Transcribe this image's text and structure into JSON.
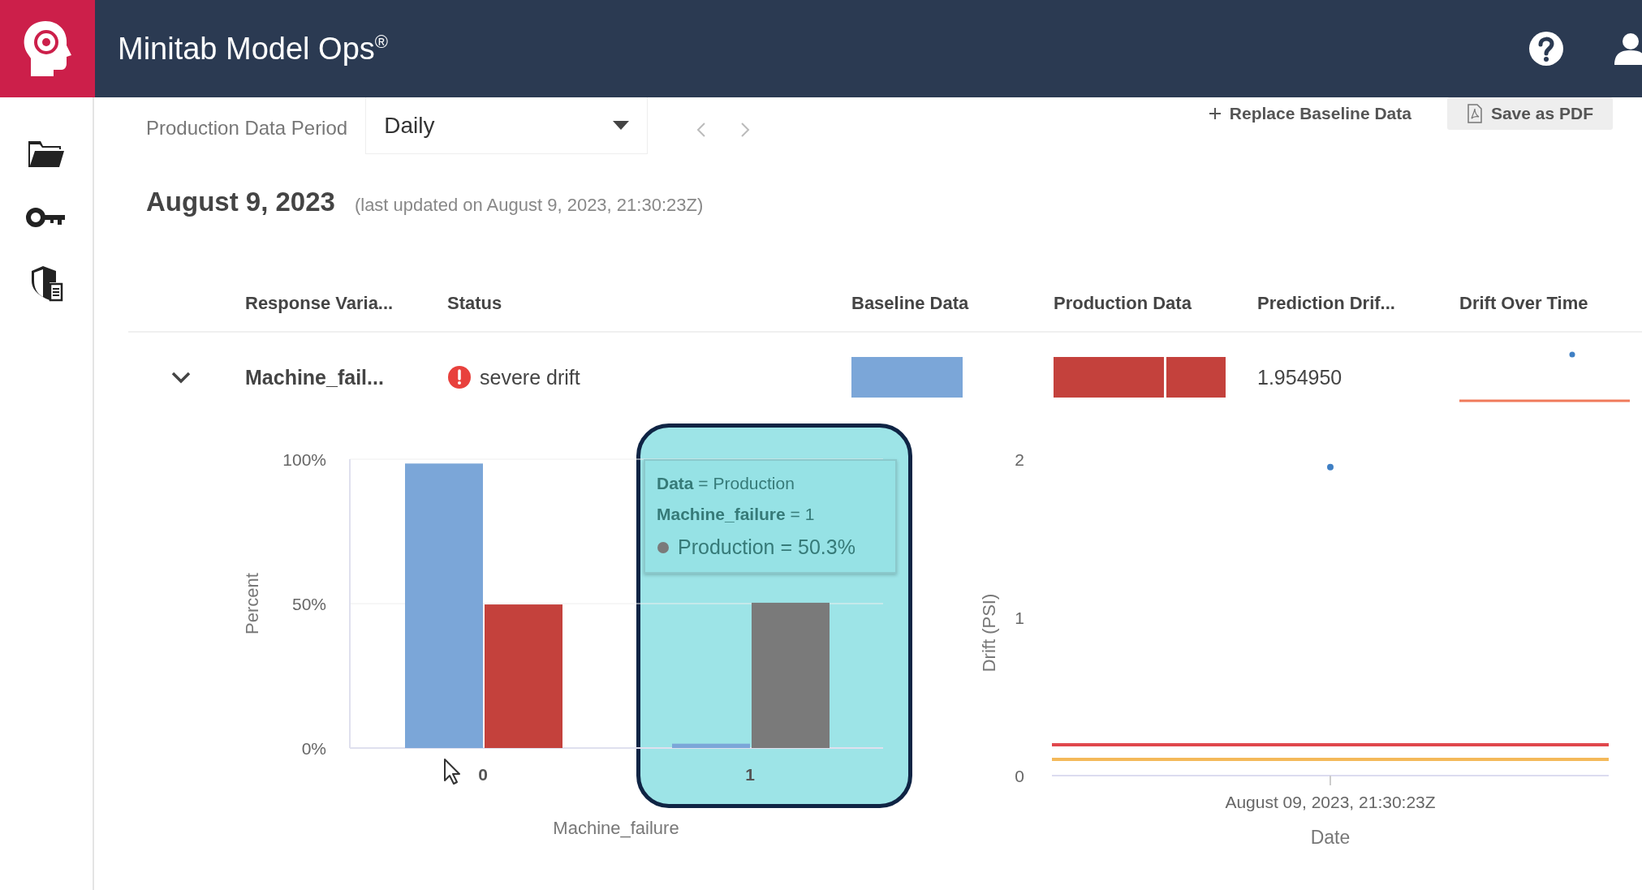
{
  "app": {
    "title": "Minitab Model Ops$^{®}$"
  },
  "toolbar": {
    "period_label": "Production Data Period",
    "period_value": "Daily",
    "replace_button": "Replace Baseline Data",
    "pdf_button": "Save as PDF"
  },
  "date_heading": {
    "date": "August 9, 2023",
    "updated": "(last updated on August 9, 2023, 21:30:23Z)"
  },
  "table": {
    "columns": [
      "Response Varia...",
      "Status",
      "Baseline Data",
      "Production Data",
      "Prediction Drif...",
      "Drift Over Time"
    ],
    "rows": [
      {
        "expanded": true,
        "response_variable": "Machine_fail...",
        "status": "severe drift",
        "color": "#e8413d",
        "prediction_drift": "1.954950"
      }
    ]
  },
  "detail": {
    "distribution": {
      "chart_data": {
        "type": "bar",
        "xlabel": "Machine_failure",
        "ylabel": "Percent",
        "categories": [
          "0",
          "1"
        ],
        "series": [
          {
            "color": "#7ba6d8",
            "values": [
              98.5,
              1.5
            ]
          },
          {
            "color": "#c4413c",
            "values": [
              49.7,
              null
            ]
          },
          {
            "color": "#7a7a7a",
            "values": [
              null,
              50.3
            ]
          }
        ],
        "ylim": [
          0,
          100
        ],
        "yticks": [
          {
            "value": 0,
            "label": "0%"
          },
          {
            "value": 50,
            "label": "50%"
          },
          {
            "value": 100,
            "label": "100%"
          }
        ]
      },
      "hover": {
        "highlighted": true
      },
      "tooltip": {
        "lines": [
          "**Data** = Production",
          "**Machine_failure** = 1"
        ],
        "value_line": "Production = 50.3%"
      }
    },
    "drift": {
      "chart_data": {
        "type": "scatter",
        "xlabel": "Date",
        "ylabel": "Drift (PSI)",
        "x": [
          "August 09, 2023, 21:30:23Z"
        ],
        "series": [
          {
            "color": "#3f7fc4",
            "values": [
              1.95
            ]
          }
        ],
        "ylim": [
          0,
          2
        ],
        "yticks": [
          0,
          1,
          2
        ]
      },
      "threshold_lines": [
        {
          "color": "#e0474c"
        },
        {
          "color": "#f4b95a"
        }
      ]
    }
  }
}
